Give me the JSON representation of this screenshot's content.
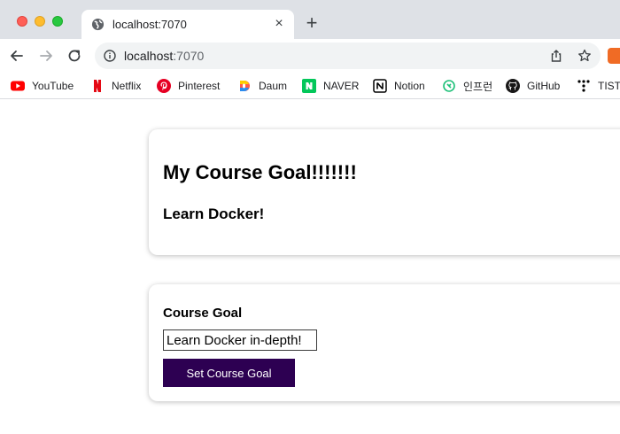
{
  "browser": {
    "tab": {
      "title": "localhost:7070",
      "close_glyph": "×"
    },
    "new_tab_glyph": "+",
    "address": {
      "host": "localhost",
      "port": ":7070"
    },
    "bookmarks": [
      {
        "label": "YouTube",
        "icon": "youtube-icon"
      },
      {
        "label": "Netflix",
        "icon": "netflix-icon"
      },
      {
        "label": "Pinterest",
        "icon": "pinterest-icon"
      },
      {
        "label": "Daum",
        "icon": "daum-icon"
      },
      {
        "label": "NAVER",
        "icon": "naver-icon"
      },
      {
        "label": "Notion",
        "icon": "notion-icon"
      },
      {
        "label": "인프런",
        "icon": "inflearn-icon"
      },
      {
        "label": "GitHub",
        "icon": "github-icon"
      },
      {
        "label": "TIST",
        "icon": "tistory-icon"
      }
    ]
  },
  "goal_card": {
    "heading": "My Course Goal!!!!!!!",
    "current_goal": "Learn Docker!"
  },
  "goal_form": {
    "label": "Course Goal",
    "input_value": "Learn Docker in-depth!",
    "button_label": "Set Course Goal"
  },
  "colors": {
    "button_bg": "#2d0052",
    "chrome_bg": "#dee1e6"
  }
}
